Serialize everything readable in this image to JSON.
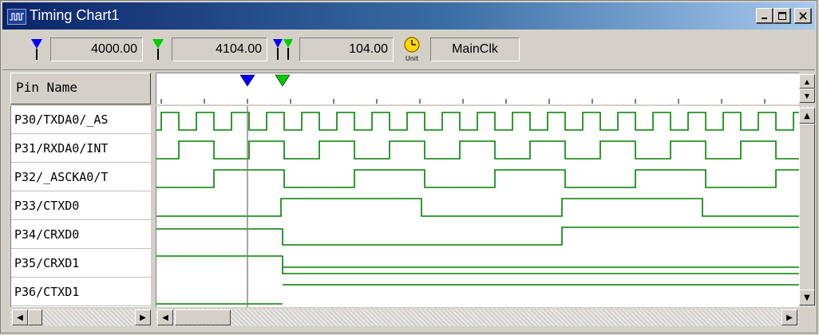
{
  "window": {
    "title": "Timing Chart1",
    "icon": "timing-chart-icon",
    "buttons": [
      "minimize",
      "maximize",
      "close"
    ]
  },
  "toolbar": {
    "cursor1_value": "4000.00",
    "cursor2_value": "4104.00",
    "diff_value": "104.00",
    "unit_label": "Unit",
    "clock_name": "MainClk",
    "colors": {
      "cursor1": "#0000ff",
      "cursor2": "#00cc00"
    }
  },
  "pin_header": "Pin Name",
  "pins": [
    "P30/TXDA0/_AS",
    "P31/RXDA0/INT",
    "P32/_ASCKA0/T",
    "P33/CTXD0",
    "P34/CRXD0",
    "P35/CRXD1",
    "P36/CTXD1"
  ],
  "waveforms": {
    "color": "#008000",
    "cursor_line_color": "#808080",
    "P30": "clock, period about 1 ruler tick",
    "P31": "clock at half frequency",
    "P32": "clock at quarter frequency",
    "P33": "clock at eighth frequency",
    "P34": "single low-to-high transition",
    "P35": "constant high then low",
    "P36": "constant high"
  }
}
